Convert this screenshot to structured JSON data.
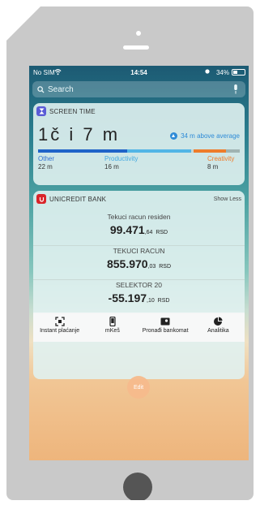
{
  "status_bar": {
    "carrier": "No SIM",
    "time": "14:54",
    "battery": "34%"
  },
  "search": {
    "placeholder": "Search"
  },
  "screen_time": {
    "title": "SCREEN TIME",
    "total": "1č i 7 m",
    "delta": "34 m above average",
    "bar": [
      {
        "name": "Other",
        "fraction": 0.44,
        "color": "#1f63c8"
      },
      {
        "name": "Productivity",
        "fraction": 0.32,
        "color": "#52b5e6"
      },
      {
        "name": "gap",
        "fraction": 0.01,
        "color": "#c6d6d5"
      },
      {
        "name": "Creativity",
        "fraction": 0.16,
        "color": "#ee7c2b"
      },
      {
        "name": "rest",
        "fraction": 0.07,
        "color": "#9fb3b2"
      }
    ],
    "categories": [
      {
        "label": "Other",
        "value": "22 m",
        "color": "#2e6ed1"
      },
      {
        "label": "Productivity",
        "value": "16 m",
        "color": "#44a9e1"
      },
      {
        "label": "Creativity",
        "value": "8 m",
        "color": "#ee7c2b"
      }
    ]
  },
  "unicredit": {
    "title": "UNICREDIT BANK",
    "show_less": "Show Less",
    "accounts": [
      {
        "name": "Tekuci racun residen",
        "amount": "99.471",
        "decimals": ",64",
        "currency": "RSD"
      },
      {
        "name": "TEKUCI RACUN",
        "amount": "855.970",
        "decimals": ",03",
        "currency": "RSD"
      },
      {
        "name": "SELEKTOR 20",
        "amount": "-55.197",
        "decimals": ",10",
        "currency": "RSD"
      }
    ],
    "actions": [
      {
        "label": "Instant plaćanje",
        "icon": "qr-scan-icon"
      },
      {
        "label": "mKeš",
        "icon": "phone-icon"
      },
      {
        "label": "Pronađi bankomat",
        "icon": "map-icon"
      },
      {
        "label": "Analitika",
        "icon": "pie-chart-icon"
      }
    ]
  },
  "edit": {
    "label": "Edit"
  }
}
